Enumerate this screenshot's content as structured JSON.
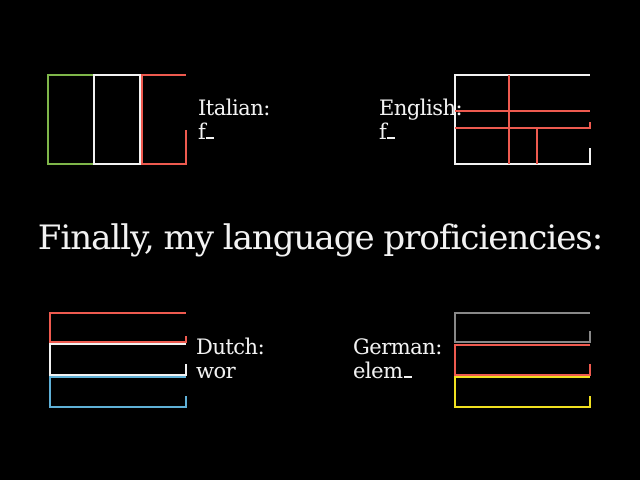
{
  "title": "Finally, my language proficiencies:",
  "languages": [
    {
      "name": "Italian:",
      "level": "f",
      "cursor": true
    },
    {
      "name": "English:",
      "level": "f",
      "cursor": true
    },
    {
      "name": "Dutch:",
      "level": "wor",
      "cursor": false
    },
    {
      "name": "German:",
      "level": "elem",
      "cursor": true
    }
  ],
  "colors": {
    "background": "#000000",
    "text": "#f2f2f2",
    "italy_green": "#7fb64a",
    "italy_white": "#f2f2f2",
    "italy_red": "#ee5a4f",
    "uk_white": "#f2f2f2",
    "uk_red": "#ee5a4f",
    "nl_red": "#ee5a4f",
    "nl_white": "#f2f2f2",
    "nl_blue": "#5fb0d6",
    "de_black": "#888888",
    "de_red": "#ee5a4f",
    "de_gold": "#f0e020"
  }
}
